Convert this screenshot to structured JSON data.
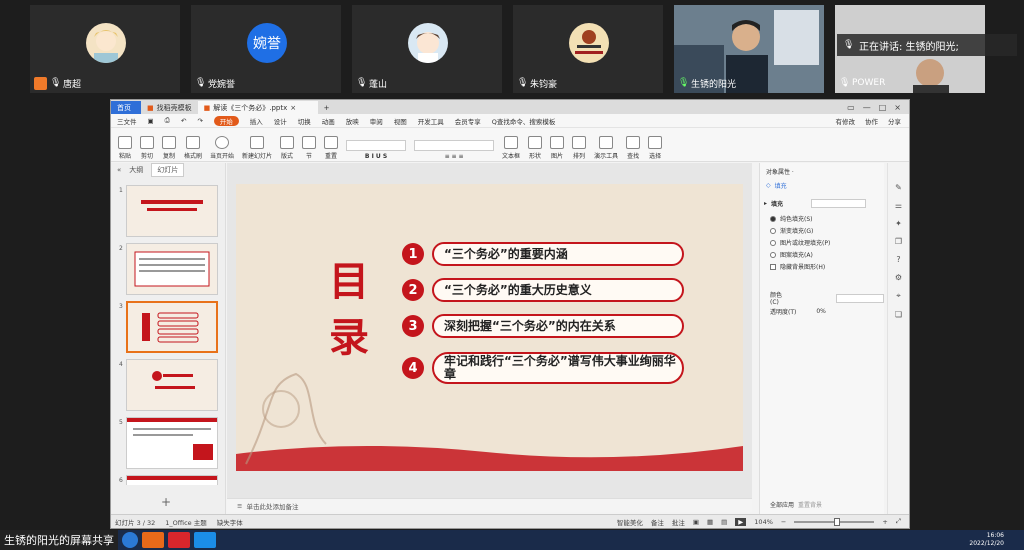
{
  "participants": [
    {
      "name": "唐超"
    },
    {
      "name": "党婉誉",
      "avatar_text": "婉誉"
    },
    {
      "name": "蓬山"
    },
    {
      "name": "朱钧豪"
    },
    {
      "name": "生锈的阳光"
    },
    {
      "name": "POWER"
    }
  ],
  "speaking": "正在讲话: 生锈的阳光;",
  "app": {
    "tabs": [
      "首页",
      "找稻壳模板",
      "解读《三个务必》.pptx"
    ],
    "menu": [
      "三文件",
      "开始",
      "插入",
      "设计",
      "切换",
      "动画",
      "放映",
      "审阅",
      "视图",
      "开发工具",
      "会员专享",
      "Q查找命令、搜索模板"
    ],
    "menu_right": [
      "有修改",
      "协作",
      "分享"
    ],
    "ribbon": [
      "粘贴",
      "剪切",
      "复制",
      "格式刷",
      "当页开始",
      "新建幻灯片",
      "版式",
      "节",
      "重置",
      "文本框",
      "形状",
      "图片",
      "排列",
      "演示工具",
      "查找",
      "选择"
    ]
  },
  "left_panel": {
    "tabs": [
      "大纲",
      "幻灯片"
    ],
    "slides": [
      "1",
      "2",
      "3",
      "4",
      "5",
      "6"
    ]
  },
  "slide": {
    "title": "目录",
    "items": [
      {
        "num": "1",
        "text": "“三个务必”的重要内涵"
      },
      {
        "num": "2",
        "text": "“三个务必”的重大历史意义"
      },
      {
        "num": "3",
        "text": "深刻把握“三个务必”的内在关系"
      },
      {
        "num": "4",
        "text": "牢记和践行“三个务必”谱写伟大事业绚丽华章"
      }
    ]
  },
  "notes_placeholder": "单击此处添加备注",
  "right_panel": {
    "title": "对象属性 ·",
    "tab": "填充",
    "section": "填充",
    "options": [
      "纯色填充(S)",
      "渐变填充(G)",
      "图片或纹理填充(P)",
      "图案填充(A)"
    ],
    "hide_bg": "隐藏背景图形(H)",
    "color_label": "颜色(C)",
    "transparency_label": "透明度(T)",
    "transparency_value": "0%",
    "apply_all": "全部应用",
    "reset_bg": "重置背景"
  },
  "status": {
    "slide": "幻灯片 3 / 32",
    "theme": "1_Office 主题",
    "font": "缺失字体",
    "smart": "智能美化",
    "notes": "备注",
    "comment": "批注",
    "zoom": "104%"
  },
  "taskbar": {
    "share": "生锈的阳光的屏幕共享",
    "time": "16:06",
    "date": "2022/12/20"
  }
}
